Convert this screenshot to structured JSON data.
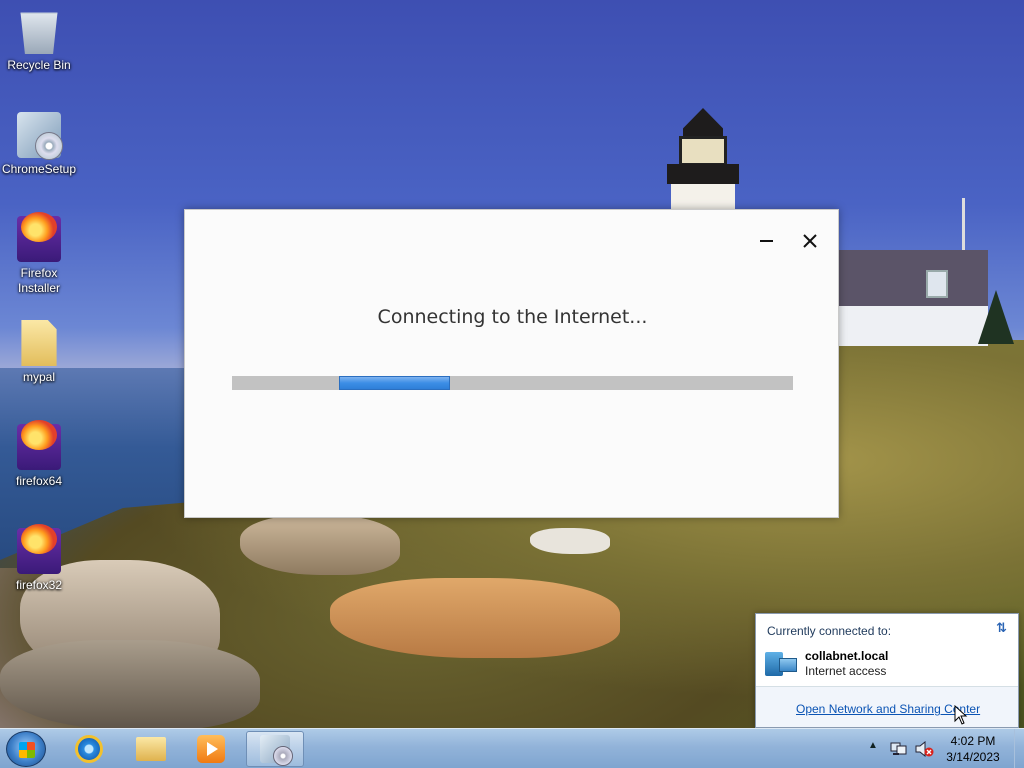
{
  "desktop": {
    "icons": [
      {
        "label": "Recycle Bin",
        "icon": "recycle-bin-icon"
      },
      {
        "label": "ChromeSetup",
        "icon": "setup-icon"
      },
      {
        "label": "Firefox Installer",
        "icon": "firefox-installer-icon"
      },
      {
        "label": "mypal",
        "icon": "folder-icon"
      },
      {
        "label": "firefox64",
        "icon": "firefox-installer-icon"
      },
      {
        "label": "firefox32",
        "icon": "firefox-installer-icon"
      }
    ]
  },
  "dialog": {
    "title": "Connecting to the Internet...",
    "progress_color": "#3c8ee6",
    "progress_note": "indeterminate marquee segment"
  },
  "network_popup": {
    "header": "Currently connected to:",
    "network_name": "collabnet.local",
    "network_status": "Internet access",
    "link": "Open Network and Sharing Center"
  },
  "taskbar": {
    "pinned": [
      "internet-explorer-icon",
      "file-explorer-icon",
      "media-player-icon",
      "setup-icon"
    ],
    "clock_time": "4:02 PM",
    "clock_date": "3/14/2023"
  }
}
